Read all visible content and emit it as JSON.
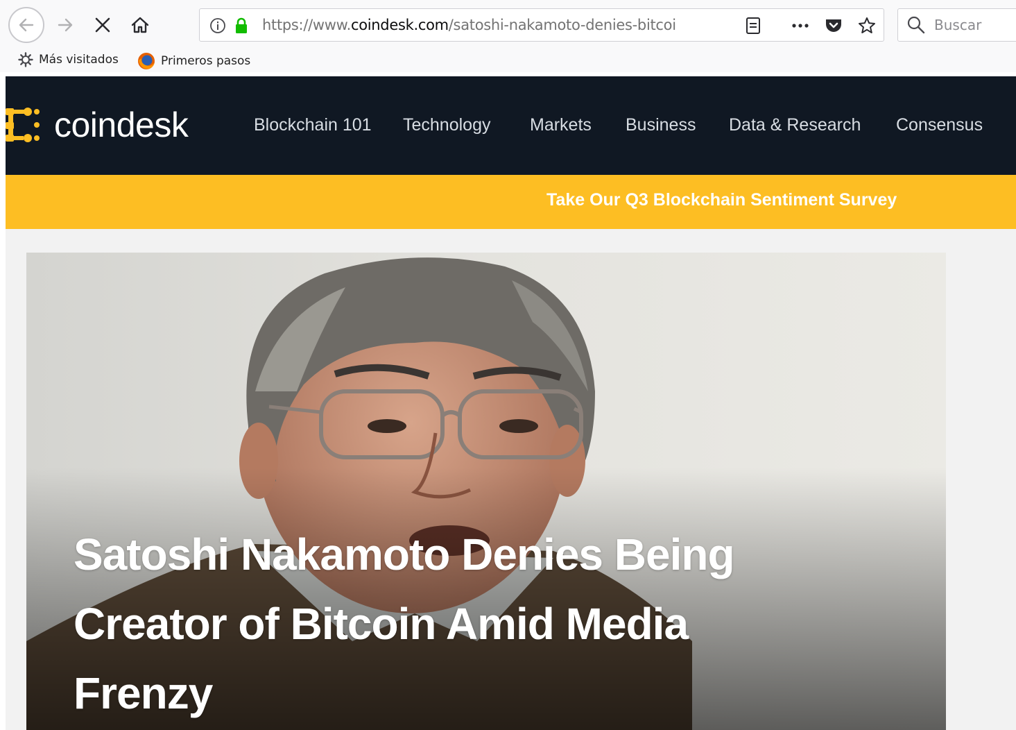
{
  "browser": {
    "url_prefix": "https://www.",
    "url_domain": "coindesk.com",
    "url_path": "/satoshi-nakamoto-denies-bitcoi",
    "search_placeholder": "Buscar",
    "bookmarks": [
      {
        "label": "Más visitados",
        "icon": "gear-icon"
      },
      {
        "label": "Primeros pasos",
        "icon": "firefox-icon"
      }
    ]
  },
  "site": {
    "logo_text": "coindesk",
    "brand_color": "#fdbe23",
    "nav_items": [
      "Blockchain 101",
      "Technology",
      "Markets",
      "Business",
      "Data & Research",
      "Consensus"
    ],
    "banner_text": "Take Our Q3 Blockchain Sentiment Survey"
  },
  "article": {
    "title": "Satoshi Nakamoto Denies Being Creator of Bitcoin Amid Media Frenzy"
  }
}
